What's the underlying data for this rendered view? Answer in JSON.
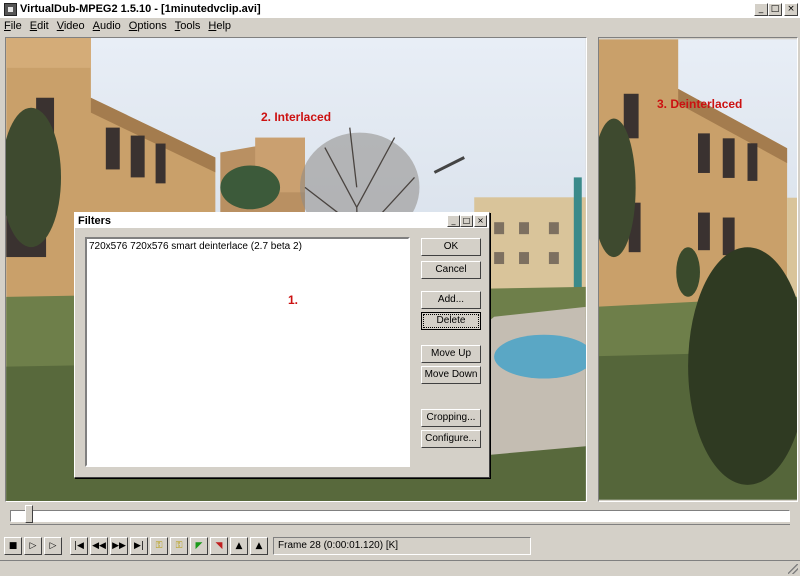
{
  "window": {
    "title": "VirtualDub-MPEG2 1.5.10 - [1minutedvclip.avi]"
  },
  "menu": [
    "File",
    "Edit",
    "Video",
    "Audio",
    "Options",
    "Tools",
    "Help"
  ],
  "panes": {
    "left_label": "2. Interlaced",
    "right_label": "3. Deinterlaced"
  },
  "dialog": {
    "title": "Filters",
    "filters": [
      "720x576  720x576  smart deinterlace (2.7 beta 2)"
    ],
    "list_label": "1.",
    "buttons": {
      "ok": "OK",
      "cancel": "Cancel",
      "add": "Add...",
      "delete": "Delete",
      "move_up": "Move Up",
      "move_down": "Move Down",
      "cropping": "Cropping...",
      "configure": "Configure..."
    }
  },
  "status": {
    "frame": "Frame 28 (0:00:01.120) [K]"
  },
  "playback": {
    "position_fraction": 0.02
  },
  "icons": [
    "app-icon",
    "minimize-icon",
    "maximize-icon",
    "close-icon",
    "stop-icon",
    "play-input-icon",
    "play-output-icon",
    "start-icon",
    "prev-frame-icon",
    "next-frame-icon",
    "end-icon",
    "prev-key-icon",
    "next-key-icon",
    "scene-back-icon",
    "scene-fwd-icon",
    "mark-in-icon",
    "mark-out-icon"
  ]
}
